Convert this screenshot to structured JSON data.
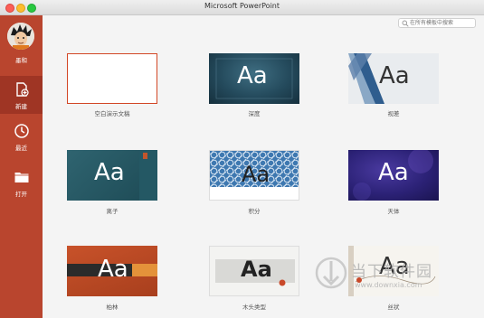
{
  "window": {
    "title": "Microsoft PowerPoint"
  },
  "sidebar": {
    "user_name": "墨和",
    "items": [
      {
        "label": "新建",
        "icon": "new-document-icon"
      },
      {
        "label": "最近",
        "icon": "clock-icon"
      },
      {
        "label": "打开",
        "icon": "folder-icon"
      }
    ]
  },
  "search": {
    "placeholder": "在所有模板中搜索"
  },
  "templates": [
    {
      "name": "空白演示文稿",
      "sample": ""
    },
    {
      "name": "深度",
      "sample": "Aa"
    },
    {
      "name": "视差",
      "sample": "Aa"
    },
    {
      "name": "离子",
      "sample": "Aa"
    },
    {
      "name": "积分",
      "sample": "Aa"
    },
    {
      "name": "天体",
      "sample": "Aa"
    },
    {
      "name": "柏林",
      "sample": "Aa"
    },
    {
      "name": "木头类型",
      "sample": "Aa"
    },
    {
      "name": "丝状",
      "sample": "Aa"
    }
  ],
  "watermark": {
    "name": "当下软件园",
    "url": "www.downxia.com"
  },
  "colors": {
    "sidebar": "#b9452e",
    "sidebar_active": "#9f3524",
    "accent": "#d24726"
  }
}
